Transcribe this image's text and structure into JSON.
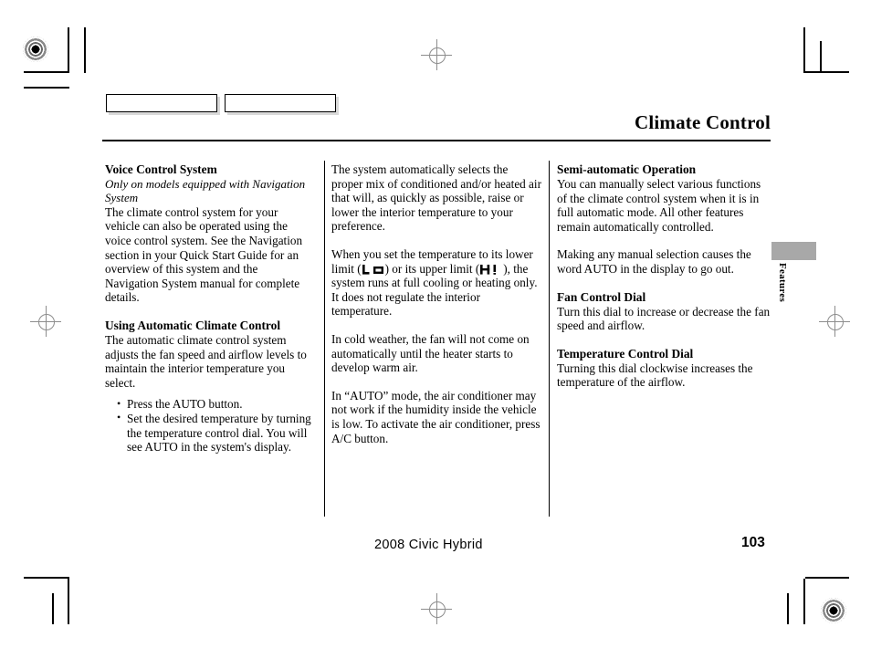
{
  "document": {
    "header_title": "Climate Control",
    "side_tab_label": "Features",
    "footer_model": "2008  Civic  Hybrid",
    "page_number": "103",
    "colors": {
      "text": "#000000",
      "paper": "#ffffff",
      "side_tab": "#a8a8a8",
      "registration_mark": "#8d8d8d"
    }
  },
  "columns": {
    "left": {
      "section_1": {
        "heading": "Voice Control System",
        "subheading": "Only on models equipped with Navigation System",
        "body": "The climate control system for your vehicle can also be operated using the voice control system. See the Navigation section in your Quick Start Guide for an overview of this system and the Navigation System manual for complete details."
      },
      "section_2": {
        "heading": "Using Automatic Climate Control",
        "body": "The automatic climate control system adjusts the fan speed and airflow levels to maintain the interior temperature you select.",
        "bullets": [
          "Press the AUTO button.",
          "Set the desired temperature by turning the temperature control dial. You will see AUTO in the system's display."
        ]
      }
    },
    "middle": {
      "paragraph_1": "The system automatically selects the proper mix of conditioned and/or heated air that will, as quickly as possible, raise or lower the interior temperature to your preference.",
      "paragraph_2_part_a": "When you set the temperature to its lower limit (",
      "paragraph_2_part_b": ") or its upper limit (",
      "paragraph_2_part_c": "), the system runs at full cooling or heating only. It does not regulate the interior temperature.",
      "lcd_low_glyph": "lcd-lo-icon",
      "lcd_high_glyph": "lcd-hi-icon",
      "paragraph_3": "In cold weather, the fan will not come on automatically until the heater starts to develop warm air.",
      "paragraph_4": "In “AUTO” mode, the air conditioner may not work if the humidity inside the vehicle is low. To activate the air conditioner, press A/C button."
    },
    "right": {
      "section_1": {
        "heading": "Semi-automatic Operation",
        "body": "You can manually select various functions of the climate control system when it is in full automatic mode. All other features remain automatically controlled.",
        "body_2": "Making any manual selection causes the word AUTO in the display to go out."
      },
      "section_2": {
        "heading": "Fan Control Dial",
        "body": "Turn this dial to increase or decrease the fan speed and airflow."
      },
      "section_3": {
        "heading": "Temperature Control Dial",
        "body": "Turning this dial clockwise increases the temperature of the airflow."
      }
    }
  }
}
